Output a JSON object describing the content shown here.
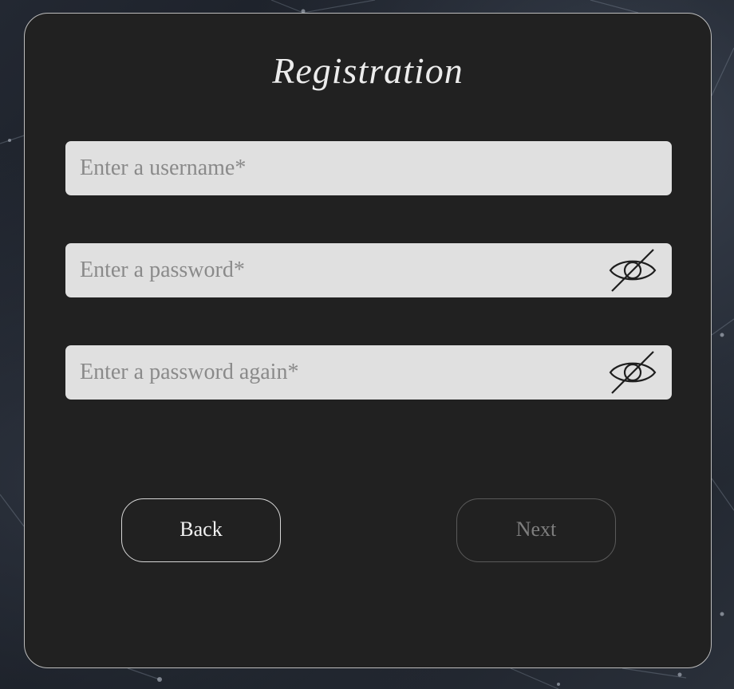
{
  "colors": {
    "panel_bg": "#212121",
    "field_bg": "#e0e0e0",
    "title_text": "#ececec",
    "back_border": "#d6d6d6",
    "next_disabled_text": "#7e7e7e"
  },
  "form": {
    "title": "Registration",
    "fields": [
      {
        "placeholder": "Enter a username*",
        "value": "",
        "has_visibility_toggle": false
      },
      {
        "placeholder": "Enter a password*",
        "value": "",
        "has_visibility_toggle": true,
        "icon": "eye-slash-icon"
      },
      {
        "placeholder": "Enter a password again*",
        "value": "",
        "has_visibility_toggle": true,
        "icon": "eye-slash-icon"
      }
    ]
  },
  "buttons": {
    "back_label": "Back",
    "next_label": "Next",
    "next_enabled": false
  }
}
